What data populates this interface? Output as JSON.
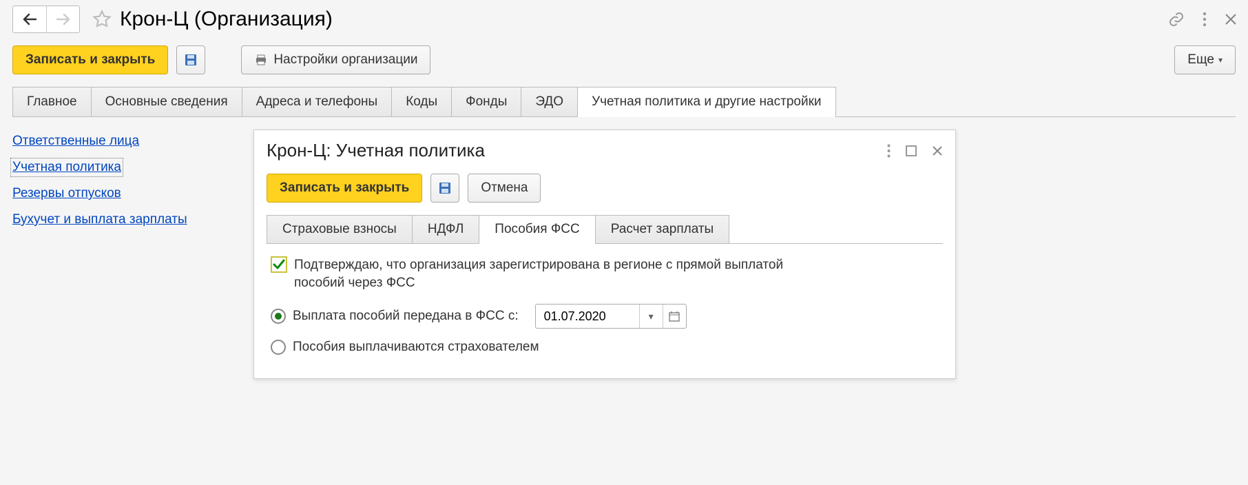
{
  "header": {
    "title": "Крон-Ц (Организация)"
  },
  "toolbar": {
    "save_and_close": "Записать и закрыть",
    "org_settings": "Настройки организации",
    "more": "Еще"
  },
  "tabs": [
    {
      "label": "Главное"
    },
    {
      "label": "Основные сведения"
    },
    {
      "label": "Адреса и телефоны"
    },
    {
      "label": "Коды"
    },
    {
      "label": "Фонды"
    },
    {
      "label": "ЭДО"
    },
    {
      "label": "Учетная политика и другие настройки",
      "active": true
    }
  ],
  "side_links": [
    {
      "label": "Ответственные лица"
    },
    {
      "label": "Учетная политика",
      "selected": true
    },
    {
      "label": "Резервы отпусков"
    },
    {
      "label": "Бухучет и выплата зарплаты"
    }
  ],
  "subwin": {
    "title": "Крон-Ц: Учетная политика",
    "save_and_close": "Записать и закрыть",
    "cancel": "Отмена",
    "tabs": [
      {
        "label": "Страховые взносы"
      },
      {
        "label": "НДФЛ"
      },
      {
        "label": "Пособия ФСС",
        "active": true
      },
      {
        "label": "Расчет зарплаты"
      }
    ],
    "panel": {
      "confirm_label": "Подтверждаю, что организация зарегистрирована в регионе с прямой выплатой пособий через ФСС",
      "radio1_label": "Выплата пособий передана в ФСС с:",
      "date_value": "01.07.2020",
      "radio2_label": "Пособия выплачиваются страхователем"
    }
  }
}
